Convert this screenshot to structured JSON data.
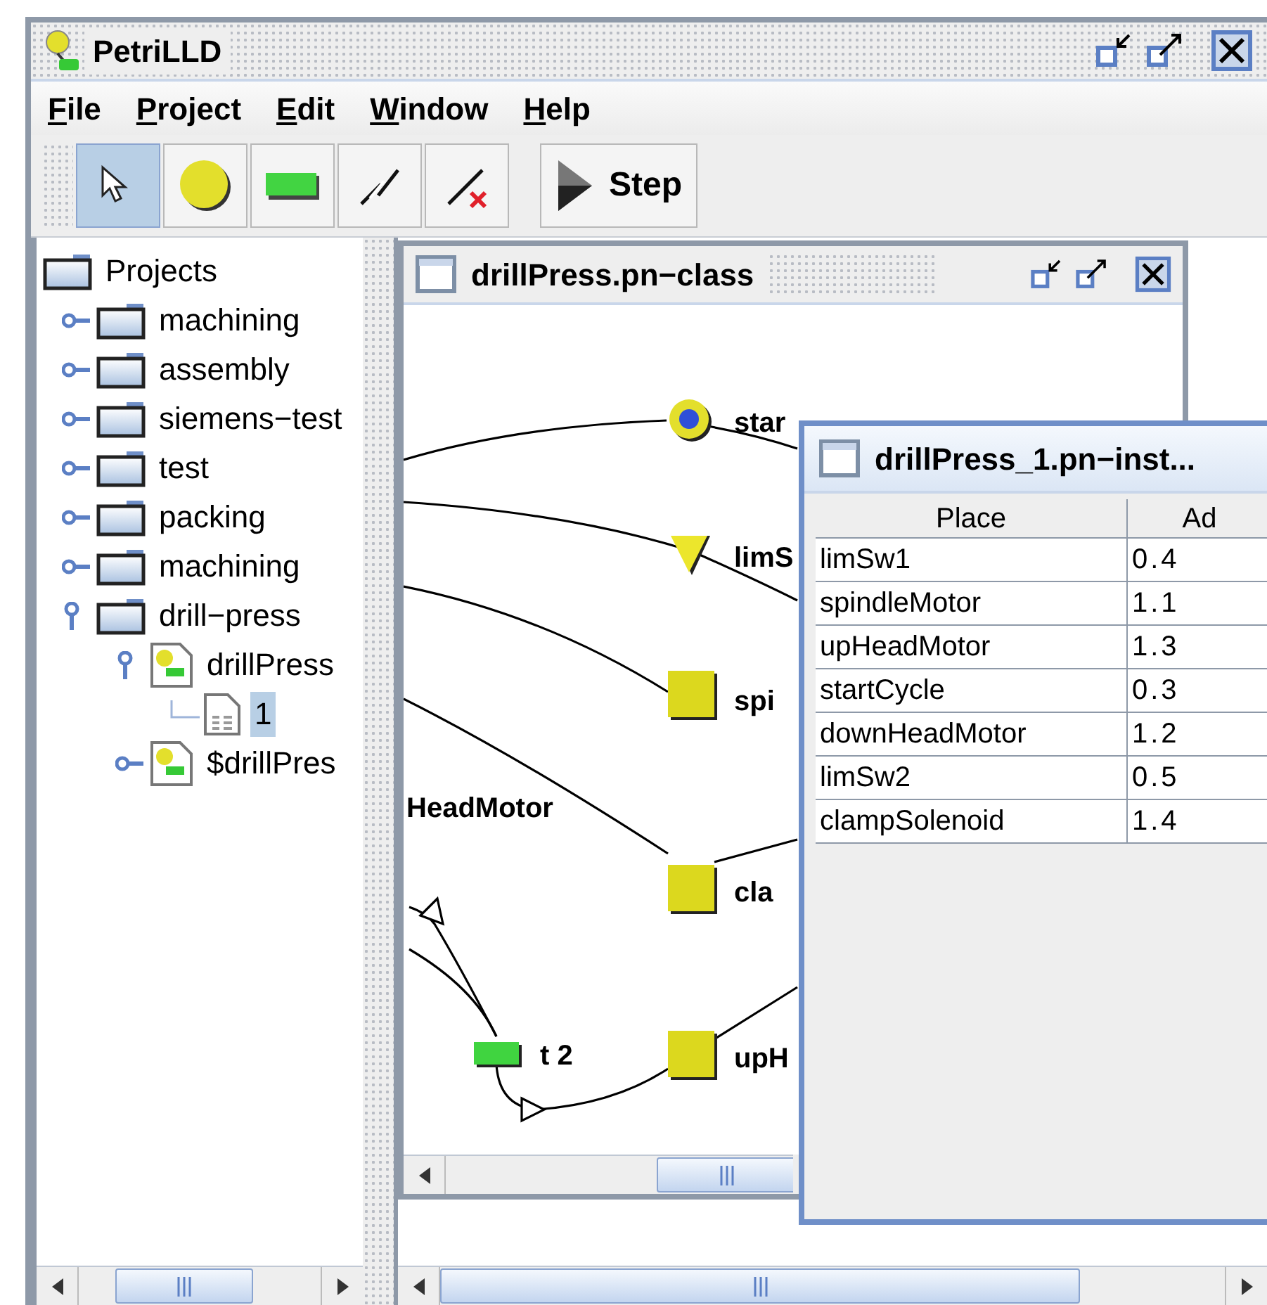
{
  "window": {
    "title": "PetriLLD"
  },
  "menu": [
    "File",
    "Project",
    "Edit",
    "Window",
    "Help"
  ],
  "toolbar": [
    {
      "kind": "select",
      "selected": true
    },
    {
      "kind": "place",
      "selected": false
    },
    {
      "kind": "transition",
      "selected": false
    },
    {
      "kind": "arc",
      "selected": false
    },
    {
      "kind": "delete-arc",
      "selected": false
    }
  ],
  "step_button": {
    "label": "Step"
  },
  "tree": {
    "label": "Projects",
    "children": [
      {
        "label": "machining",
        "kind": "folder",
        "expanded": false
      },
      {
        "label": "assembly",
        "kind": "folder",
        "expanded": false
      },
      {
        "label": "siemens−test",
        "kind": "folder",
        "expanded": false
      },
      {
        "label": "test",
        "kind": "folder",
        "expanded": false
      },
      {
        "label": "packing",
        "kind": "folder",
        "expanded": false
      },
      {
        "label": "machining",
        "kind": "folder",
        "expanded": false
      },
      {
        "label": "drill−press",
        "kind": "folder",
        "expanded": true,
        "children": [
          {
            "label": "drillPress",
            "kind": "net",
            "expanded": true,
            "children": [
              {
                "label": "1",
                "kind": "instance",
                "selected": true
              }
            ]
          },
          {
            "label": "$drillPres",
            "kind": "net",
            "expanded": false
          }
        ]
      }
    ]
  },
  "class_frame": {
    "title": "drillPress.pn−class",
    "nodes": [
      {
        "kind": "marked-place",
        "label": "star"
      },
      {
        "kind": "triangle",
        "label": "limS"
      },
      {
        "kind": "square",
        "label": "spi"
      },
      {
        "kind": "text",
        "label": "HeadMotor"
      },
      {
        "kind": "square",
        "label": "cla"
      },
      {
        "kind": "transition",
        "label": "t 2"
      },
      {
        "kind": "square",
        "label": "upH"
      }
    ]
  },
  "instance_frame": {
    "title": "drillPress_1.pn−inst...",
    "columns": [
      "Place",
      "Ad"
    ],
    "rows": [
      [
        "limSw1",
        "0.4"
      ],
      [
        "spindleMotor",
        "1.1"
      ],
      [
        "upHeadMotor",
        "1.3"
      ],
      [
        "startCycle",
        "0.3"
      ],
      [
        "downHeadMotor",
        "1.2"
      ],
      [
        "limSw2",
        "0.5"
      ],
      [
        "clampSolenoid",
        "1.4"
      ]
    ]
  }
}
